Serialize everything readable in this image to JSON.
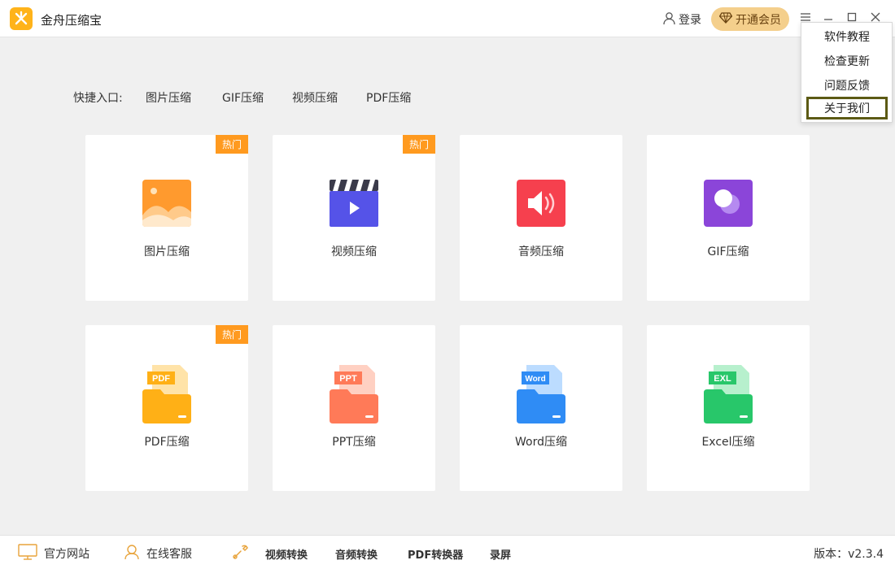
{
  "app": {
    "title": "金舟压缩宝",
    "accent": "#ffb31a"
  },
  "header": {
    "login_label": "登录",
    "vip_label": "开通会员",
    "vip_color": "#f4cf8c",
    "icons": [
      "user-icon",
      "diamond-icon",
      "menu-icon",
      "minimize-icon",
      "maximize-icon",
      "close-icon"
    ]
  },
  "menu": {
    "items": [
      {
        "label": "软件教程"
      },
      {
        "label": "检查更新"
      },
      {
        "label": "问题反馈"
      },
      {
        "label": "关于我们",
        "focused": true
      }
    ]
  },
  "quick": {
    "label": "快捷入口:",
    "links": [
      {
        "label": "图片压缩"
      },
      {
        "label": "GIF压缩"
      },
      {
        "label": "视频压缩"
      },
      {
        "label": "PDF压缩"
      }
    ]
  },
  "cards": [
    {
      "label": "图片压缩",
      "badge": "热门",
      "icon": "image-icon",
      "color": "#ff9a2e"
    },
    {
      "label": "视频压缩",
      "badge": "热门",
      "icon": "video-icon",
      "color": "#5553e8"
    },
    {
      "label": "音频压缩",
      "icon": "audio-icon",
      "color": "#f6404e"
    },
    {
      "label": "GIF压缩",
      "icon": "gif-icon",
      "color": "#8b45d9"
    },
    {
      "label": "PDF压缩",
      "badge": "热门",
      "icon": "pdf-file-icon",
      "tag": "PDF",
      "color": "#ffb016"
    },
    {
      "label": "PPT压缩",
      "icon": "ppt-file-icon",
      "tag": "PPT",
      "color": "#ff7a58"
    },
    {
      "label": "Word压缩",
      "icon": "word-file-icon",
      "tag": "Word",
      "color": "#2f8cf5"
    },
    {
      "label": "Excel压缩",
      "icon": "excel-file-icon",
      "tag": "EXL",
      "color": "#28c76a"
    }
  ],
  "footer": {
    "website": "官方网站",
    "support": "在线客服",
    "tools": [
      {
        "label": "视频转换"
      },
      {
        "label": "音频转换"
      },
      {
        "label": "PDF转换器"
      },
      {
        "label": "录屏"
      }
    ],
    "version": "版本：v2.3.4"
  }
}
